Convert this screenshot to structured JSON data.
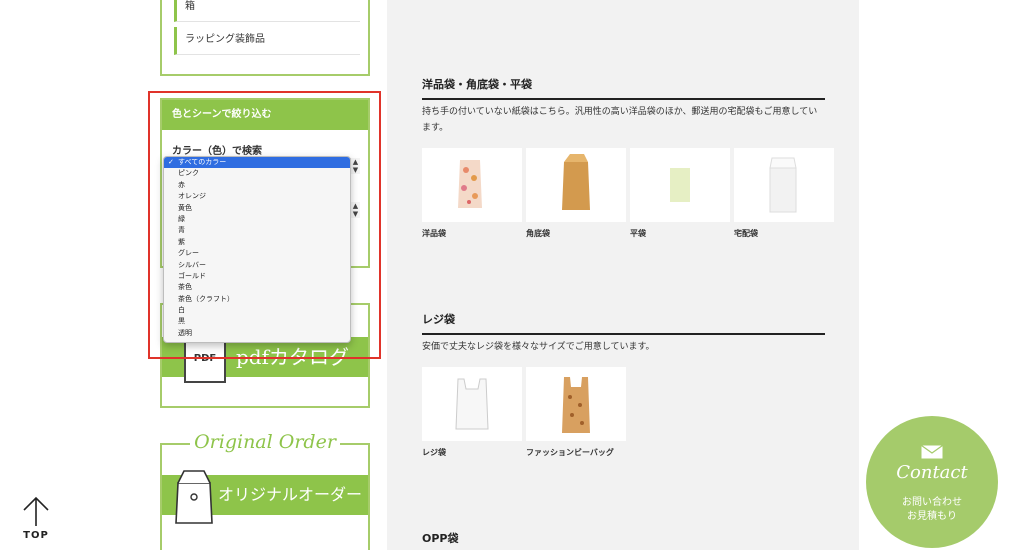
{
  "sidebar": {
    "categories": [
      {
        "label": "箱"
      },
      {
        "label": "ラッピング装飾品"
      }
    ],
    "filter": {
      "heading": "色とシーンで絞り込む",
      "color_label": "カラー（色）で検索",
      "color_options": [
        "すべてのカラー",
        "ピンク",
        "赤",
        "オレンジ",
        "黄色",
        "緑",
        "青",
        "紫",
        "グレー",
        "シルバー",
        "ゴールド",
        "茶色",
        "茶色（クラフト）",
        "白",
        "黒",
        "透明"
      ],
      "selected_index": 0
    },
    "pdf_catalog": {
      "icon_text": "PDF",
      "label": "pdfカタログ"
    },
    "original_order": {
      "title": "Original Order",
      "label": "オリジナルオーダー"
    }
  },
  "sections": [
    {
      "title": "洋品袋・角底袋・平袋",
      "desc": "持ち手の付いていない紙袋はこちら。汎用性の高い洋品袋のほか、郵送用の宅配袋もご用意しています。",
      "products": [
        {
          "name": "洋品袋"
        },
        {
          "name": "角底袋"
        },
        {
          "name": "平袋"
        },
        {
          "name": "宅配袋"
        }
      ]
    },
    {
      "title": "レジ袋",
      "desc": "安価で丈夫なレジ袋を様々なサイズでご用意しています。",
      "products": [
        {
          "name": "レジ袋"
        },
        {
          "name": "ファッションビーバッグ"
        }
      ]
    },
    {
      "title": "OPP袋"
    }
  ],
  "top_button": {
    "label": "TOP"
  },
  "contact": {
    "title": "Contact",
    "sub1": "お問い合わせ",
    "sub2": "お見積もり"
  },
  "colors": {
    "accent": "#8ec44a",
    "highlight": "#e0332a",
    "select_blue": "#2f6de1",
    "contact_bg": "#a5cb6b"
  }
}
